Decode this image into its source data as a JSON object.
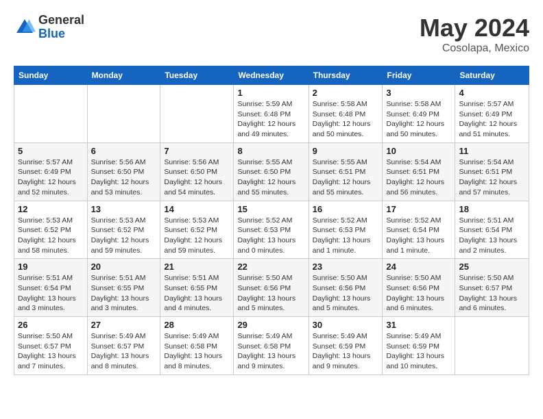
{
  "header": {
    "logo_general": "General",
    "logo_blue": "Blue",
    "month_title": "May 2024",
    "location": "Cosolapa, Mexico"
  },
  "weekdays": [
    "Sunday",
    "Monday",
    "Tuesday",
    "Wednesday",
    "Thursday",
    "Friday",
    "Saturday"
  ],
  "weeks": [
    [
      {
        "day": "",
        "info": ""
      },
      {
        "day": "",
        "info": ""
      },
      {
        "day": "",
        "info": ""
      },
      {
        "day": "1",
        "info": "Sunrise: 5:59 AM\nSunset: 6:48 PM\nDaylight: 12 hours\nand 49 minutes."
      },
      {
        "day": "2",
        "info": "Sunrise: 5:58 AM\nSunset: 6:48 PM\nDaylight: 12 hours\nand 50 minutes."
      },
      {
        "day": "3",
        "info": "Sunrise: 5:58 AM\nSunset: 6:49 PM\nDaylight: 12 hours\nand 50 minutes."
      },
      {
        "day": "4",
        "info": "Sunrise: 5:57 AM\nSunset: 6:49 PM\nDaylight: 12 hours\nand 51 minutes."
      }
    ],
    [
      {
        "day": "5",
        "info": "Sunrise: 5:57 AM\nSunset: 6:49 PM\nDaylight: 12 hours\nand 52 minutes."
      },
      {
        "day": "6",
        "info": "Sunrise: 5:56 AM\nSunset: 6:50 PM\nDaylight: 12 hours\nand 53 minutes."
      },
      {
        "day": "7",
        "info": "Sunrise: 5:56 AM\nSunset: 6:50 PM\nDaylight: 12 hours\nand 54 minutes."
      },
      {
        "day": "8",
        "info": "Sunrise: 5:55 AM\nSunset: 6:50 PM\nDaylight: 12 hours\nand 55 minutes."
      },
      {
        "day": "9",
        "info": "Sunrise: 5:55 AM\nSunset: 6:51 PM\nDaylight: 12 hours\nand 55 minutes."
      },
      {
        "day": "10",
        "info": "Sunrise: 5:54 AM\nSunset: 6:51 PM\nDaylight: 12 hours\nand 56 minutes."
      },
      {
        "day": "11",
        "info": "Sunrise: 5:54 AM\nSunset: 6:51 PM\nDaylight: 12 hours\nand 57 minutes."
      }
    ],
    [
      {
        "day": "12",
        "info": "Sunrise: 5:53 AM\nSunset: 6:52 PM\nDaylight: 12 hours\nand 58 minutes."
      },
      {
        "day": "13",
        "info": "Sunrise: 5:53 AM\nSunset: 6:52 PM\nDaylight: 12 hours\nand 59 minutes."
      },
      {
        "day": "14",
        "info": "Sunrise: 5:53 AM\nSunset: 6:52 PM\nDaylight: 12 hours\nand 59 minutes."
      },
      {
        "day": "15",
        "info": "Sunrise: 5:52 AM\nSunset: 6:53 PM\nDaylight: 13 hours\nand 0 minutes."
      },
      {
        "day": "16",
        "info": "Sunrise: 5:52 AM\nSunset: 6:53 PM\nDaylight: 13 hours\nand 1 minute."
      },
      {
        "day": "17",
        "info": "Sunrise: 5:52 AM\nSunset: 6:54 PM\nDaylight: 13 hours\nand 1 minute."
      },
      {
        "day": "18",
        "info": "Sunrise: 5:51 AM\nSunset: 6:54 PM\nDaylight: 13 hours\nand 2 minutes."
      }
    ],
    [
      {
        "day": "19",
        "info": "Sunrise: 5:51 AM\nSunset: 6:54 PM\nDaylight: 13 hours\nand 3 minutes."
      },
      {
        "day": "20",
        "info": "Sunrise: 5:51 AM\nSunset: 6:55 PM\nDaylight: 13 hours\nand 3 minutes."
      },
      {
        "day": "21",
        "info": "Sunrise: 5:51 AM\nSunset: 6:55 PM\nDaylight: 13 hours\nand 4 minutes."
      },
      {
        "day": "22",
        "info": "Sunrise: 5:50 AM\nSunset: 6:56 PM\nDaylight: 13 hours\nand 5 minutes."
      },
      {
        "day": "23",
        "info": "Sunrise: 5:50 AM\nSunset: 6:56 PM\nDaylight: 13 hours\nand 5 minutes."
      },
      {
        "day": "24",
        "info": "Sunrise: 5:50 AM\nSunset: 6:56 PM\nDaylight: 13 hours\nand 6 minutes."
      },
      {
        "day": "25",
        "info": "Sunrise: 5:50 AM\nSunset: 6:57 PM\nDaylight: 13 hours\nand 6 minutes."
      }
    ],
    [
      {
        "day": "26",
        "info": "Sunrise: 5:50 AM\nSunset: 6:57 PM\nDaylight: 13 hours\nand 7 minutes."
      },
      {
        "day": "27",
        "info": "Sunrise: 5:49 AM\nSunset: 6:57 PM\nDaylight: 13 hours\nand 8 minutes."
      },
      {
        "day": "28",
        "info": "Sunrise: 5:49 AM\nSunset: 6:58 PM\nDaylight: 13 hours\nand 8 minutes."
      },
      {
        "day": "29",
        "info": "Sunrise: 5:49 AM\nSunset: 6:58 PM\nDaylight: 13 hours\nand 9 minutes."
      },
      {
        "day": "30",
        "info": "Sunrise: 5:49 AM\nSunset: 6:59 PM\nDaylight: 13 hours\nand 9 minutes."
      },
      {
        "day": "31",
        "info": "Sunrise: 5:49 AM\nSunset: 6:59 PM\nDaylight: 13 hours\nand 10 minutes."
      },
      {
        "day": "",
        "info": ""
      }
    ]
  ]
}
